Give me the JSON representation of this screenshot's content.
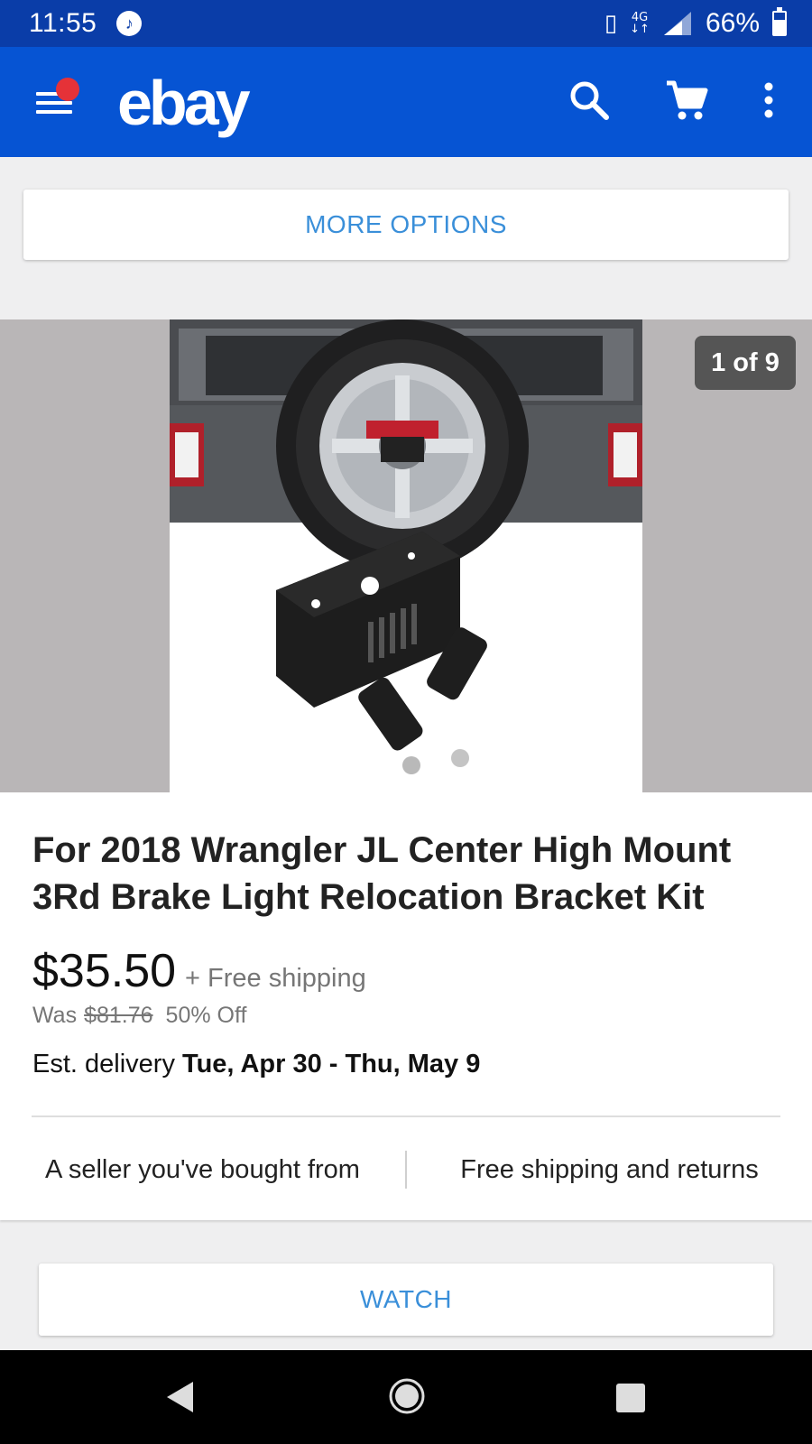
{
  "status_bar": {
    "time": "11:55",
    "network_top": "4G",
    "battery_percent": "66%",
    "battery_level": 0.66,
    "icons": [
      "music-note-icon",
      "vibrate-icon",
      "signal-icon",
      "battery-icon"
    ]
  },
  "app_bar": {
    "logo": "ebay",
    "icons": [
      "hamburger-menu-icon",
      "search-icon",
      "cart-icon",
      "more-vert-icon"
    ],
    "notification_color": "#e53238",
    "background": "#0654d3"
  },
  "more_options": {
    "label": "MORE OPTIONS"
  },
  "gallery": {
    "counter": "1 of 9"
  },
  "item": {
    "title": "For 2018 Wrangler JL Center High Mount 3Rd Brake Light Relocation Bracket Kit",
    "price": "$35.50",
    "shipping": "+ Free shipping",
    "was_label": "Was",
    "was_price": "$81.76",
    "discount": "50% Off",
    "delivery_label": "Est. delivery",
    "delivery_dates": "Tue, Apr 30 - Thu, May 9"
  },
  "badges": {
    "seller": "A seller you've bought from",
    "returns": "Free shipping and returns"
  },
  "watch": {
    "label": "WATCH"
  },
  "accent_color": "#3a8fd9"
}
